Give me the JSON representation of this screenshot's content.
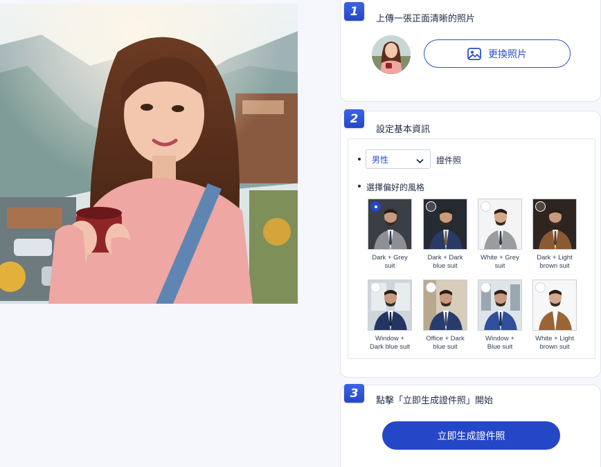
{
  "steps": [
    {
      "number": "1",
      "title": "上傳一張正面清晰的照片"
    },
    {
      "number": "2",
      "title": "設定基本資訊"
    },
    {
      "number": "3",
      "title": "點擊「立即生成證件照」開始"
    }
  ],
  "upload": {
    "change_label": "更換照片"
  },
  "basic": {
    "gender_value": "男性",
    "id_photo_label": "證件照",
    "style_heading": "選擇偏好的風格"
  },
  "styles": [
    {
      "line1": "Dark + Grey",
      "line2": "suit",
      "selected": true
    },
    {
      "line1": "Dark + Dark",
      "line2": "blue suit",
      "selected": false
    },
    {
      "line1": "White + Grey",
      "line2": "suit",
      "selected": false
    },
    {
      "line1": "Dark + Light",
      "line2": "brown suit",
      "selected": false
    },
    {
      "line1": "Window +",
      "line2": "Dark blue suit",
      "selected": false
    },
    {
      "line1": "Office + Dark",
      "line2": "blue suit",
      "selected": false
    },
    {
      "line1": "Window +",
      "line2": "Blue suit",
      "selected": false
    },
    {
      "line1": "White + Light",
      "line2": "brown suit",
      "selected": false
    }
  ],
  "generate": {
    "label": "立即生成證件照"
  },
  "colors": {
    "accent": "#2447c8",
    "card_border": "#e1e5ee",
    "background": "#f5f7fc"
  }
}
